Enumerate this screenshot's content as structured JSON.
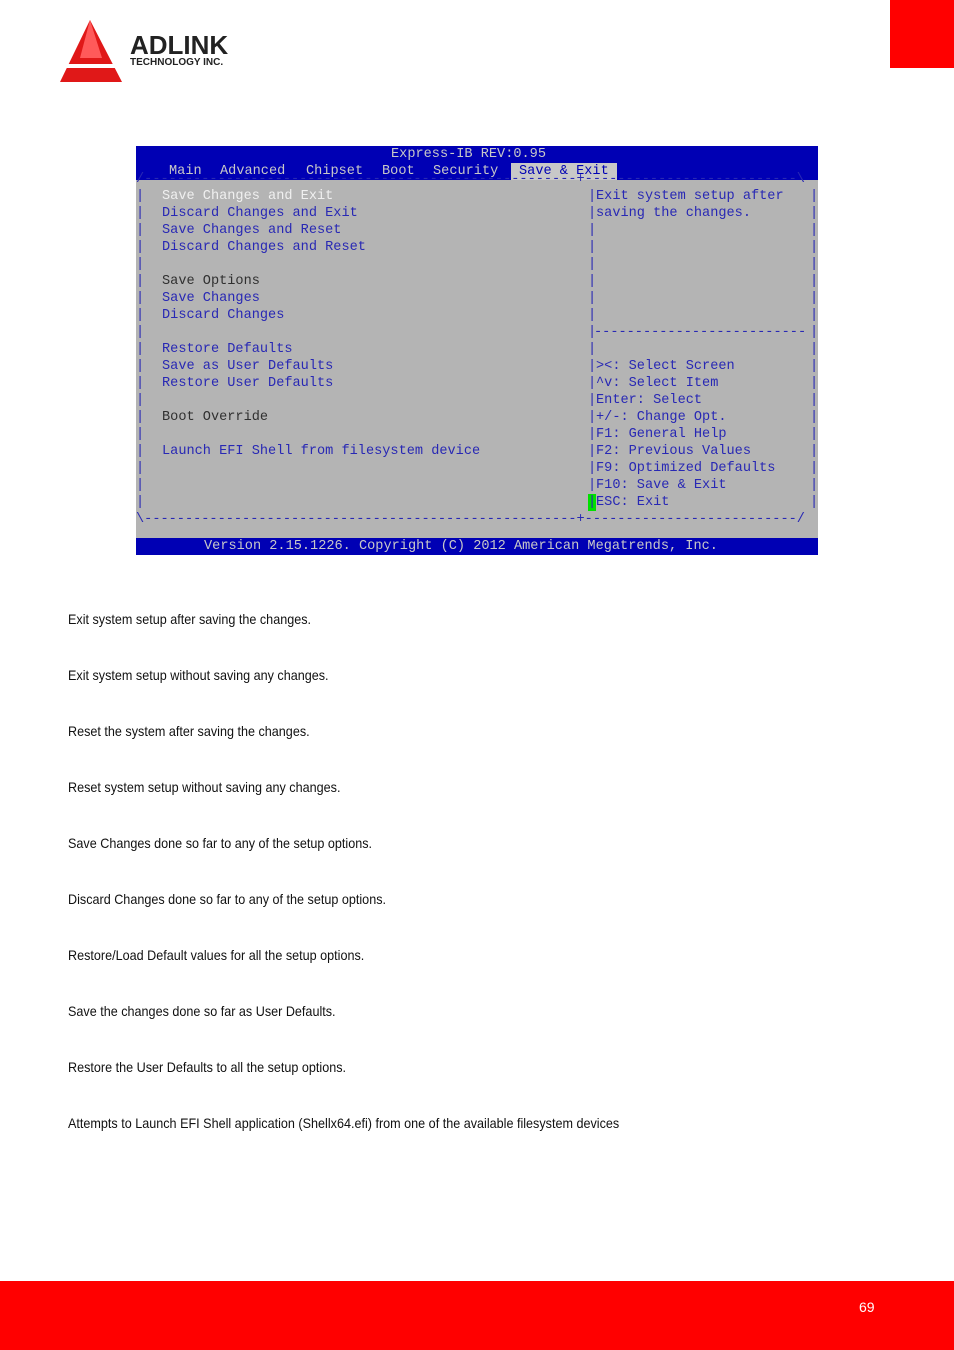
{
  "logo": {
    "brand": "ADLINK",
    "sub": "TECHNOLOGY INC."
  },
  "bios": {
    "title": "Express-IB REV:0.95",
    "tabs": [
      {
        "label": "Main"
      },
      {
        "label": "Advanced"
      },
      {
        "label": "Chipset"
      },
      {
        "label": "Boot"
      },
      {
        "label": "Security"
      },
      {
        "label": "Save & Exit",
        "active": true
      }
    ],
    "menu": [
      "Save Changes and Exit",
      "Discard Changes and Exit",
      "Save Changes and Reset",
      "Discard Changes and Reset",
      "Save Options",
      "Save Changes",
      "Discard Changes",
      "Restore Defaults",
      "Save as User Defaults",
      "Restore User Defaults",
      "Boot Override",
      "Launch EFI Shell from filesystem device"
    ],
    "help": [
      "Exit system setup after",
      "saving the changes."
    ],
    "keys": [
      "><: Select Screen",
      "^v: Select Item",
      "Enter: Select",
      "+/-: Change Opt.",
      "F1: General Help",
      "F2: Previous Values",
      "F9: Optimized Defaults",
      "F10: Save & Exit",
      "ESC: Exit"
    ],
    "version": "Version 2.15.1226. Copyright (C) 2012 American Megatrends, Inc.",
    "colors": {
      "bar": "#0000b4",
      "panel": "#b4b4b4",
      "text": "#2828b4",
      "cursor": "#00e000"
    }
  },
  "descriptions": [
    "Exit system setup after saving the changes.",
    "Exit system setup without saving any changes.",
    "Reset the system after saving the changes.",
    "Reset system setup without saving any changes.",
    "Save Changes done so far to any of the setup options.",
    "Discard Changes done so far to any of the setup options.",
    "Restore/Load Default values for all the setup options.",
    "Save the changes done so far as User Defaults.",
    "Restore the User Defaults to all the setup options.",
    "Attempts to Launch EFI Shell application (Shellx64.efi) from one of the available filesystem devices"
  ],
  "footer": {
    "page": "69"
  },
  "colors": {
    "brand": "#ff0000"
  }
}
